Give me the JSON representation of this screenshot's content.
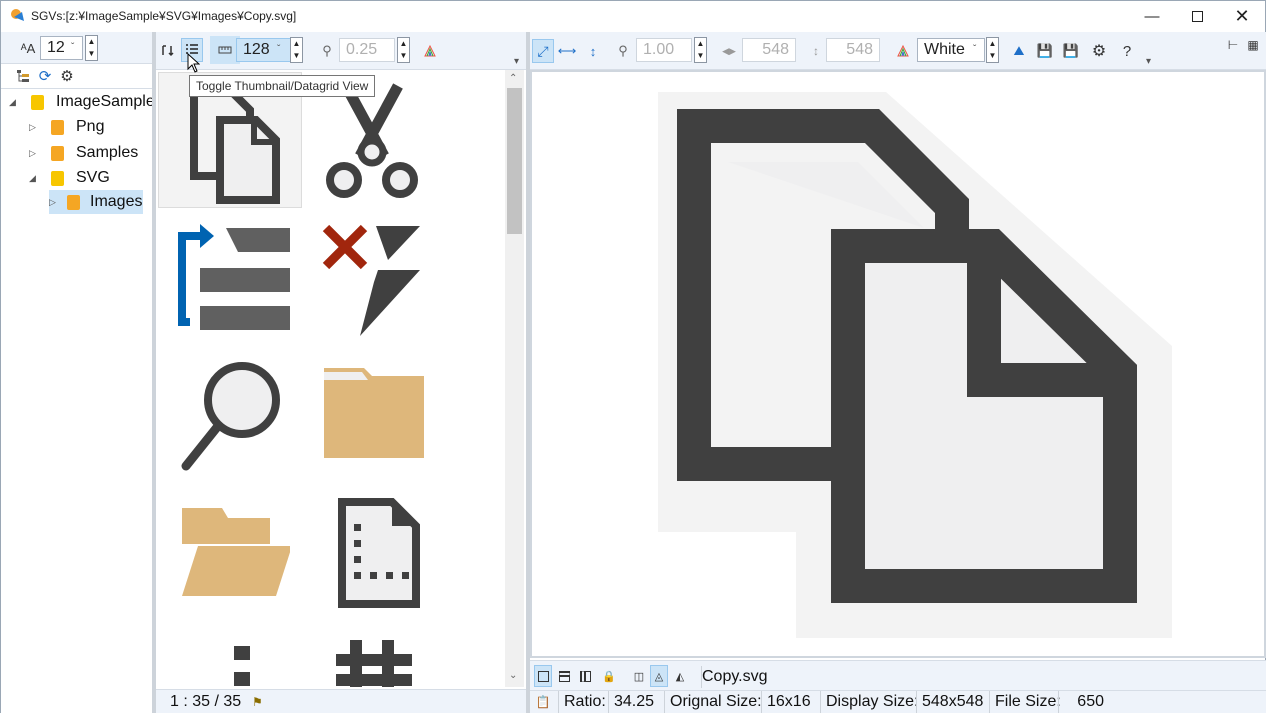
{
  "window": {
    "title": "SGVs:[z:¥ImageSample¥SVG¥Images¥Copy.svg]",
    "min_icon": "minimize-icon",
    "max_icon": "maximize-icon",
    "close_icon": "close-icon"
  },
  "left_toolbar": {
    "font_size_value": "12"
  },
  "tree": {
    "items": [
      {
        "label": "ImageSample",
        "expanded": true
      },
      {
        "label": "Png",
        "expanded": false
      },
      {
        "label": "Samples",
        "expanded": false
      },
      {
        "label": "SVG",
        "expanded": true
      },
      {
        "label": "Images",
        "expanded": false,
        "selected": true
      }
    ]
  },
  "thumb_toolbar": {
    "thumb_size_value": "128",
    "zoom_value": "0.25",
    "tooltip": "Toggle Thumbnail/Datagrid View"
  },
  "thumb_status": {
    "position": "1 : 35 / 35"
  },
  "preview_toolbar": {
    "zoom_value": "1.00",
    "width_value": "548",
    "height_value": "548",
    "background_value": "White"
  },
  "preview_bottom": {
    "filename": "Copy.svg",
    "ratio_label": "Ratio:",
    "ratio_value": "34.25",
    "orig_label": "Orignal Size:",
    "orig_value": "16x16",
    "disp_label": "Display Size:",
    "disp_value": "548x548",
    "file_label": "File Size:",
    "file_value": "650"
  },
  "colors": {
    "icon_dark": "#404040",
    "icon_fill": "#efeff0",
    "folder_tan": "#deb77b",
    "folder_yellow": "#f7c600",
    "folder_orange": "#f5a623",
    "accent_blue": "#0063b1",
    "red_x": "#a1260d"
  }
}
